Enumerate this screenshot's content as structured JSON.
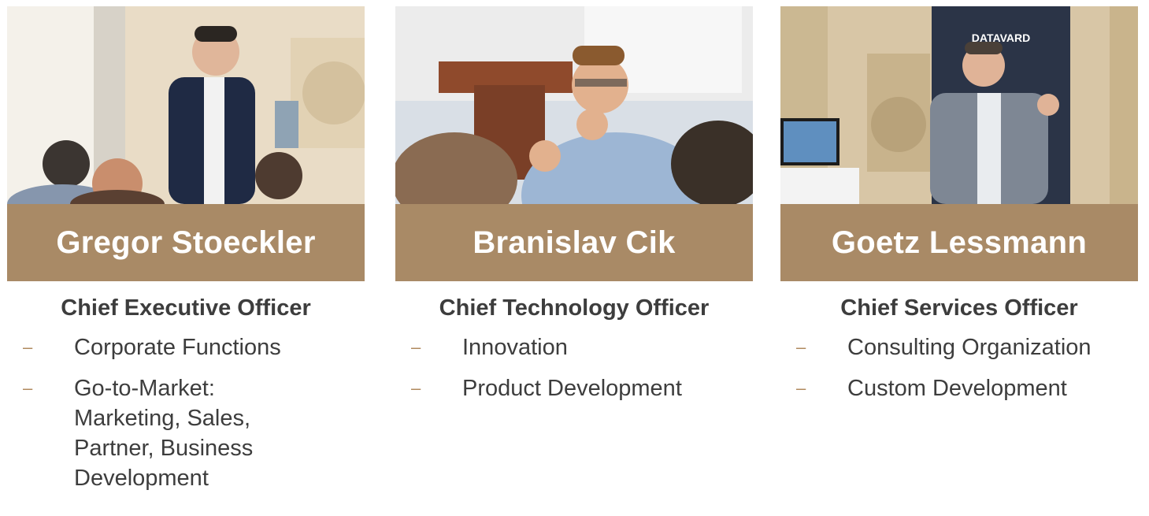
{
  "colors": {
    "name_bar": "#a98a66",
    "dash": "#b08a5e",
    "text": "#3d3d3d"
  },
  "people": [
    {
      "name": "Gregor Stoeckler",
      "role": "Chief Executive Officer",
      "items": [
        "Corporate Functions",
        "Go-to-Market: Marketing, Sales, Partner, Business Development"
      ]
    },
    {
      "name": "Branislav Cik",
      "role": "Chief Technology Officer",
      "items": [
        "Innovation",
        "Product Development"
      ]
    },
    {
      "name": "Goetz Lessmann",
      "role": "Chief Services Officer",
      "items": [
        "Consulting Organization",
        "Custom Development"
      ]
    }
  ],
  "bullet_glyph": "–",
  "banner_text": "DATAVARD"
}
